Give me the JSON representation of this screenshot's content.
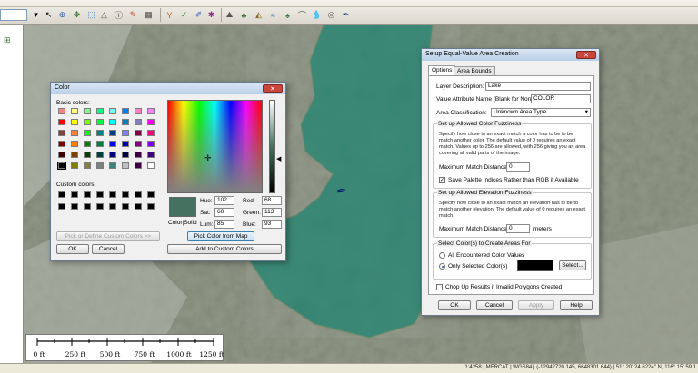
{
  "color_dialog": {
    "title": "Color",
    "close_symbol": "✕",
    "basic_colors_label": "Basic colors:",
    "basic_colors": [
      "#ff8080",
      "#ffff80",
      "#80ff80",
      "#00ff80",
      "#80ffff",
      "#0080ff",
      "#ff80c0",
      "#ff80ff",
      "#ff0000",
      "#ffff00",
      "#80ff00",
      "#00ff40",
      "#00ffff",
      "#0080c0",
      "#8080c0",
      "#ff00ff",
      "#804040",
      "#ff8040",
      "#00ff00",
      "#008080",
      "#004080",
      "#8080ff",
      "#800040",
      "#ff0080",
      "#800000",
      "#ff8000",
      "#008000",
      "#008040",
      "#0000ff",
      "#0000a0",
      "#800080",
      "#8000ff",
      "#400000",
      "#804000",
      "#004000",
      "#004040",
      "#000080",
      "#000040",
      "#400040",
      "#400080",
      "#000000",
      "#808000",
      "#808040",
      "#808080",
      "#408080",
      "#c0c0c0",
      "#400040",
      "#ffffff"
    ],
    "custom_colors_label": "Custom colors:",
    "define_custom_button": "Pick or Define Custom Colors >>",
    "ok_button": "OK",
    "cancel_button": "Cancel",
    "color_solid_label": "Color|Solid",
    "selected_color": "#447160",
    "hue_label": "Hue:",
    "hue_value": "102",
    "sat_label": "Sat:",
    "sat_value": "60",
    "lum_label": "Lum:",
    "lum_value": "85",
    "red_label": "Red:",
    "red_value": "68",
    "green_label": "Green:",
    "green_value": "113",
    "blue_label": "Blue:",
    "blue_value": "93",
    "pick_from_map_button": "Pick Color from Map",
    "add_custom_button": "Add to Custom Colors"
  },
  "area_dialog": {
    "title": "Setup Equal-Value Area Creation",
    "close_symbol": "✕",
    "tabs": [
      "Options",
      "Area Bounds"
    ],
    "layer_description_label": "Layer Description:",
    "layer_description_value": "Lake",
    "value_attribute_label": "Value Attribute Name (Blank for None):",
    "value_attribute_value": "COLOR",
    "area_classification_label": "Area Classification:",
    "area_classification_value": "Unknown Area Type",
    "color_fuzziness_title": "Set up Allowed Color Fuzziness",
    "color_fuzziness_text": "Specify how close to an exact match a color has to be to be match another color. The default value of 0 requires an exact match. Values up to 256 are allowed, with 256 giving you an area covering all valid parts of the image.",
    "max_match_label": "Maximum Match Distance:",
    "max_match_value": "0",
    "save_palette_label": "Save Palette Indices Rather than RGB if Available",
    "save_palette_checked": true,
    "elevation_fuzziness_title": "Set up Allowed Elevation Fuzziness",
    "elevation_fuzziness_text": "Specify how close to an exact match an elevation has to be to match another elevation. The default value of 0 requires an exact match.",
    "elev_max_match_label": "Maximum Match Distance:",
    "elev_max_match_value": "0",
    "elev_units": "meters",
    "select_colors_title": "Select Color(s) to Create Areas For",
    "all_colors_label": "All Encountered Color Values",
    "only_selected_label": "Only Selected Color(s)",
    "select_button": "Select...",
    "chop_up_label": "Chop Up Results if Invalid Polygons Created",
    "chop_up_checked": false,
    "ok_button": "OK",
    "cancel_button": "Cancel",
    "apply_button": "Apply",
    "help_button": "Help"
  },
  "scale_bar": {
    "labels": [
      "0 ft",
      "250 ft",
      "500 ft",
      "750 ft",
      "1000 ft",
      "1250 ft"
    ]
  },
  "status_bar": {
    "text": "1:4258 | MERCAT | WGS84 | (-12942720.145, 6648301.644) | 51° 20' 24.6224\" N, 116° 15' 59.1"
  },
  "colors": {
    "lake": "#3a8a78",
    "terrain": "#8d9483",
    "selected": "#447160"
  }
}
